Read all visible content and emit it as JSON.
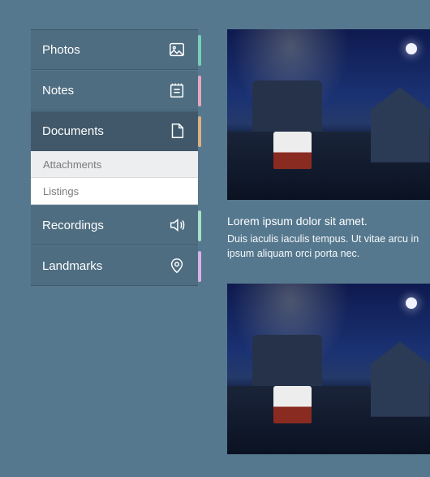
{
  "sidebar": {
    "items": [
      {
        "label": "Photos",
        "accent": "#78d0b8"
      },
      {
        "label": "Notes",
        "accent": "#e7a6bf"
      },
      {
        "label": "Documents",
        "accent": "#d9b184",
        "active": true
      },
      {
        "label": "Recordings",
        "accent": "#a6e2c7"
      },
      {
        "label": "Landmarks",
        "accent": "#d7b3e8"
      }
    ],
    "sub_items": [
      {
        "label": "Attachments"
      },
      {
        "label": "Listings"
      }
    ]
  },
  "content": {
    "cards": [
      {
        "title": "Lorem ipsum dolor sit amet.",
        "desc": "Duis iaculis iaculis tempus. Ut vitae arcu in ipsum aliquam orci porta nec."
      },
      {
        "title": "",
        "desc": ""
      }
    ]
  }
}
